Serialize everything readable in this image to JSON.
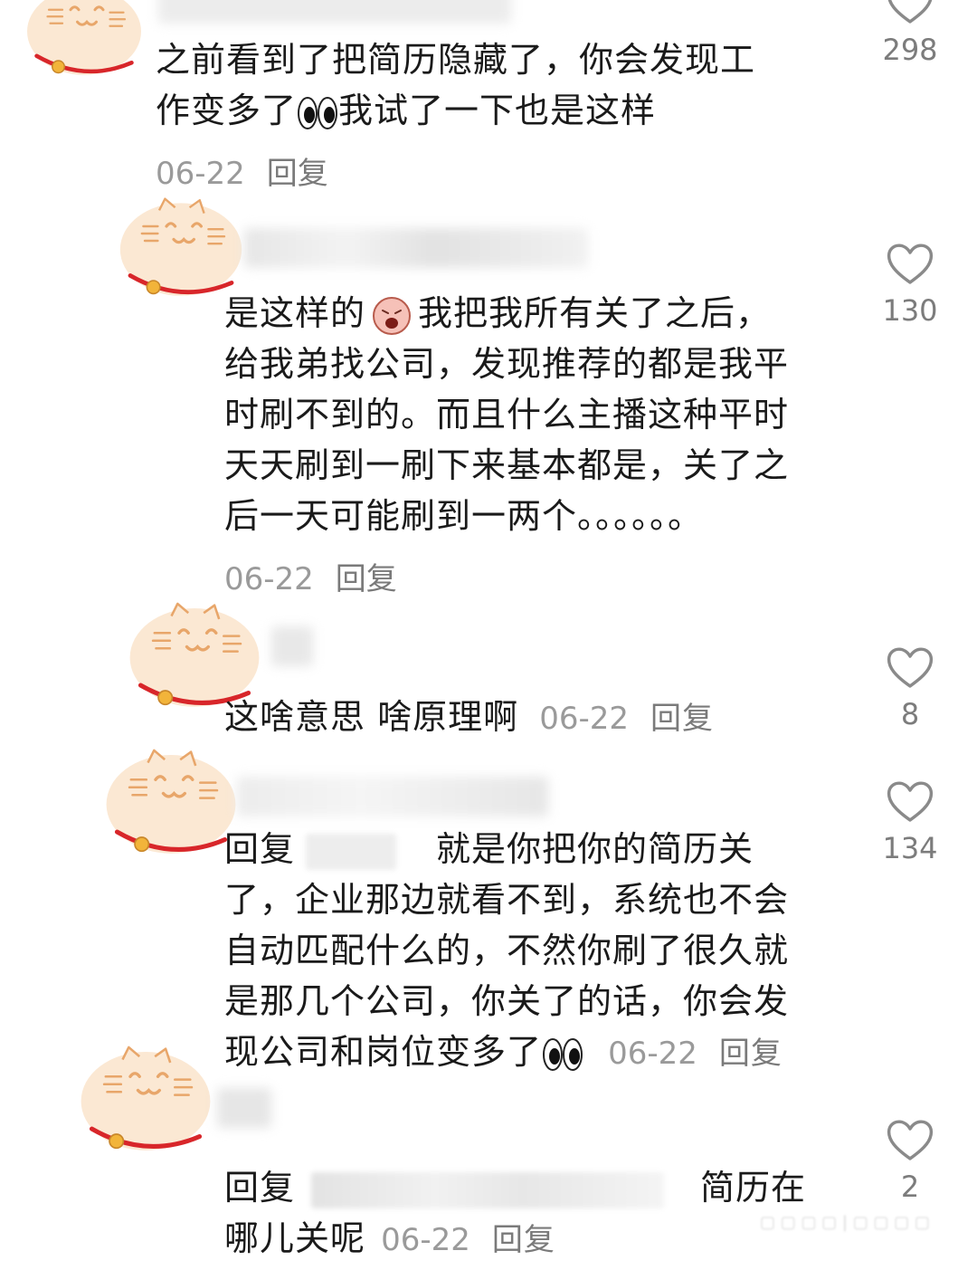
{
  "comments": [
    {
      "text_lines": [
        "之前看到了把简历隐藏了，你会发现工",
        "作变多了"
      ],
      "eyes_emoji": "👀",
      "text_after_emoji": "我试了一下也是这样",
      "date": "06-22",
      "reply_label": "回复",
      "likes": "298"
    },
    {
      "text_line1_before": "是这样的",
      "text_line1_emoji": "😫",
      "text_line1_after": "我把我所有关了之后，",
      "text_lines": [
        "给我弟找公司，发现推荐的都是我平",
        "时刷不到的。而且什么主播这种平时",
        "天天刷到一刷下来基本都是，关了之",
        "后一天可能刷到一两个。。。。。。"
      ],
      "date": "06-22",
      "reply_label": "回复",
      "likes": "130"
    },
    {
      "text": "这啥意思 啥原理啊",
      "date": "06-22",
      "reply_label": "回复",
      "likes": "8"
    },
    {
      "reply_prefix": "回复",
      "text_line1": "就是你把你的简历关",
      "text_lines": [
        "了，企业那边就看不到，系统也不会",
        "自动匹配什么的，不然你刷了很久就",
        "是那几个公司，你关了的话，你会发"
      ],
      "last_line": "现公司和岗位变多了",
      "eyes_emoji": "👀",
      "date": "06-22",
      "reply_label": "回复",
      "likes": "134"
    },
    {
      "reply_prefix": "回复",
      "text_line1": "简历在",
      "text_line2": "哪儿关呢",
      "date": "06-22",
      "reply_label": "回复",
      "likes": "2"
    }
  ],
  "colors": {
    "avatar_fill": "#fbe8d3",
    "avatar_stroke": "#e8a66a",
    "collar": "#d8262a",
    "bell": "#f2b43a",
    "heart": "#8a8a8a"
  }
}
